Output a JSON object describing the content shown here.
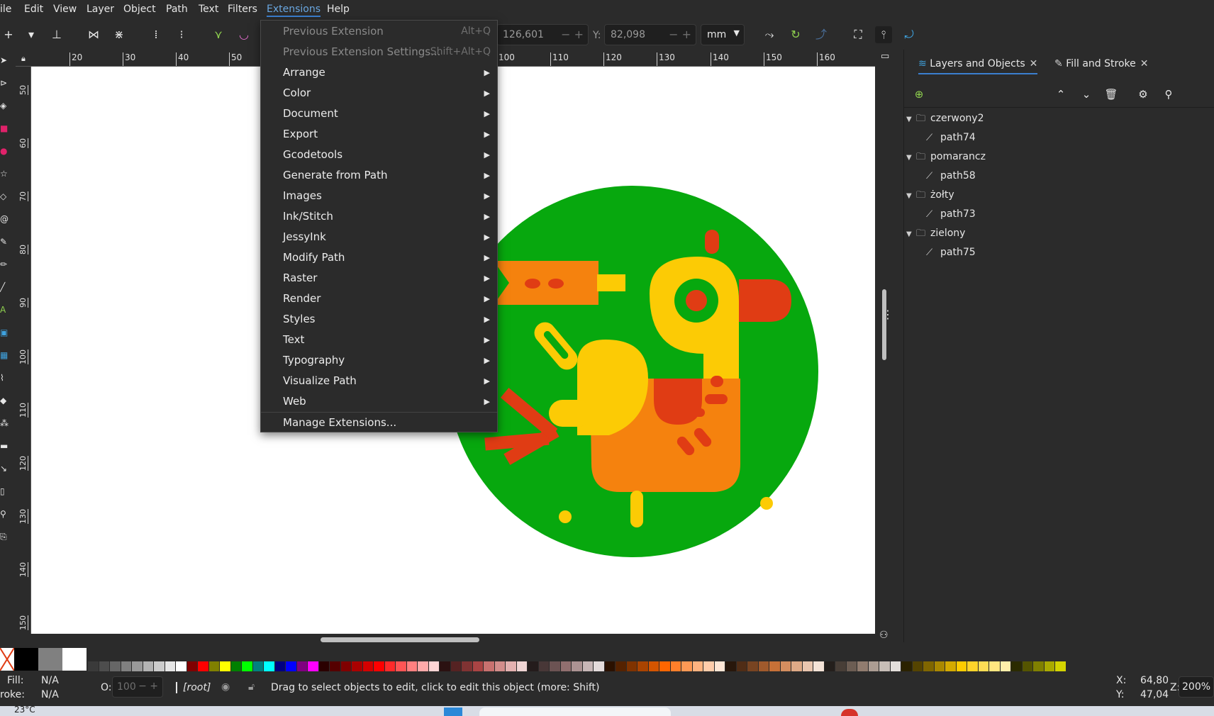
{
  "menubar": {
    "items": [
      "ile",
      "Edit",
      "View",
      "Layer",
      "Object",
      "Path",
      "Text",
      "Filters",
      "Extensions",
      "Help"
    ],
    "active_index": 8
  },
  "toolbar": {
    "x_value": "126,601",
    "y_label": "Y:",
    "y_value": "82,098",
    "unit": "mm"
  },
  "hruler": {
    "labels": [
      "20",
      "30",
      "40",
      "50",
      "100",
      "110",
      "120",
      "130",
      "140",
      "150",
      "160"
    ]
  },
  "vruler": {
    "labels": [
      "50",
      "60",
      "70",
      "80",
      "90",
      "100",
      "110",
      "120",
      "130",
      "140",
      "150"
    ]
  },
  "extensions_menu": {
    "items": [
      {
        "label": "Previous Extension",
        "accel": "Alt+Q",
        "disabled": true
      },
      {
        "label": "Previous Extension Settings...",
        "accel": "Shift+Alt+Q",
        "disabled": true
      },
      {
        "label": "Arrange",
        "submenu": true
      },
      {
        "label": "Color",
        "submenu": true
      },
      {
        "label": "Document",
        "submenu": true
      },
      {
        "label": "Export",
        "submenu": true
      },
      {
        "label": "Gcodetools",
        "submenu": true
      },
      {
        "label": "Generate from Path",
        "submenu": true
      },
      {
        "label": "Images",
        "submenu": true
      },
      {
        "label": "Ink/Stitch",
        "submenu": true
      },
      {
        "label": "JessyInk",
        "submenu": true
      },
      {
        "label": "Modify Path",
        "submenu": true
      },
      {
        "label": "Raster",
        "submenu": true
      },
      {
        "label": "Render",
        "submenu": true
      },
      {
        "label": "Styles",
        "submenu": true
      },
      {
        "label": "Text",
        "submenu": true
      },
      {
        "label": "Typography",
        "submenu": true
      },
      {
        "label": "Visualize Path",
        "submenu": true
      },
      {
        "label": "Web",
        "submenu": true
      }
    ],
    "manage": "Manage Extensions..."
  },
  "panel": {
    "tab_layers": "Layers and Objects",
    "tab_fill": "Fill and Stroke",
    "tree": [
      {
        "layer": "czerwony2",
        "child": "path74"
      },
      {
        "layer": "pomarancz",
        "child": "path58"
      },
      {
        "layer": "żołty",
        "child": "path73"
      },
      {
        "layer": "zielony",
        "child": "path75"
      }
    ]
  },
  "status": {
    "fill_label": "Fill:",
    "fill_value": "N/A",
    "stroke_label": "roke:",
    "stroke_value": "N/A",
    "opacity_label": "O:",
    "opacity_value": "100",
    "layer": "[root]",
    "message": "Drag to select objects to edit, click to edit this object (more: Shift)",
    "x_label": "X:",
    "x_value": "64,80",
    "y_label": "Y:",
    "y_value": "47,04",
    "zoom_label": "Z:",
    "zoom_value": "200%"
  },
  "taskbar": {
    "temperature": "23°C"
  },
  "colors": {
    "green": "#07a80e",
    "yellow": "#fccb05",
    "orange": "#f5820e",
    "red": "#e03c14",
    "accent": "#3b7fcf"
  }
}
